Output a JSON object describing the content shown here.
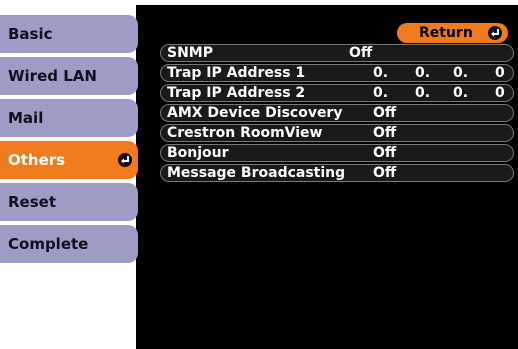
{
  "tabs": [
    {
      "label": "Basic"
    },
    {
      "label": "Wired LAN"
    },
    {
      "label": "Mail"
    },
    {
      "label": "Others"
    },
    {
      "label": "Reset"
    },
    {
      "label": "Complete"
    }
  ],
  "active_tab": "Others",
  "return_label": "Return",
  "rows": {
    "snmp": {
      "label": "SNMP",
      "value": "Off"
    },
    "trap1": {
      "label": "Trap IP Address 1",
      "ip": [
        "0.",
        "0.",
        "0.",
        "0"
      ]
    },
    "trap2": {
      "label": "Trap IP Address 2",
      "ip": [
        "0.",
        "0.",
        "0.",
        "0"
      ]
    },
    "amx": {
      "label": "AMX Device Discovery",
      "value": "Off"
    },
    "crestron": {
      "label": "Crestron RoomView",
      "value": "Off"
    },
    "bonjour": {
      "label": "Bonjour",
      "value": "Off"
    },
    "broadcast": {
      "label": "Message Broadcasting",
      "value": "Off"
    }
  },
  "colors": {
    "accent": "#f07a1e",
    "tab": "#9c9cc4",
    "panel": "#000000"
  },
  "icons": [
    "enter-icon"
  ]
}
